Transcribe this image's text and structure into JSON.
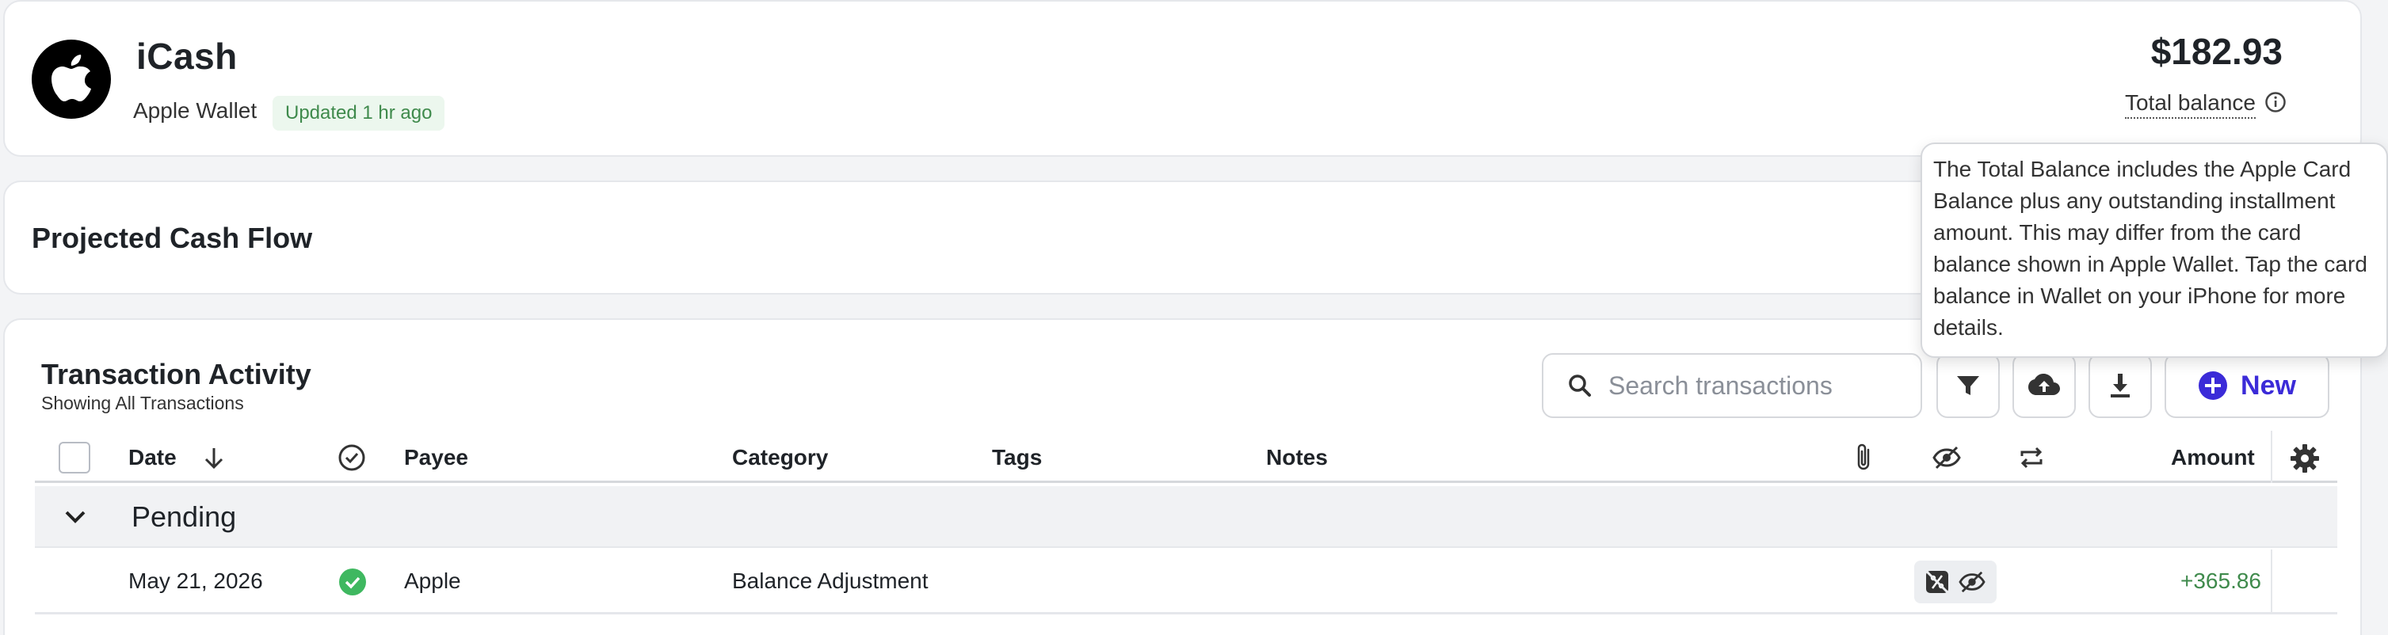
{
  "account": {
    "name": "iCash",
    "source": "Apple Wallet",
    "updated": "Updated 1 hr ago",
    "balance": "$182.93",
    "balance_label": "Total balance",
    "logo_icon": "apple-logo-icon"
  },
  "cashflow": {
    "title": "Projected Cash Flow"
  },
  "activity": {
    "title": "Transaction Activity",
    "subtitle": "Showing All Transactions",
    "search_placeholder": "Search transactions",
    "new_label": "New",
    "columns": {
      "date": "Date",
      "payee": "Payee",
      "category": "Category",
      "tags": "Tags",
      "notes": "Notes",
      "amount": "Amount"
    },
    "groups": [
      {
        "label": "Pending",
        "transactions": [
          {
            "date": "May 21, 2026",
            "reviewed": true,
            "payee": "Apple",
            "category": "Balance Adjustment",
            "tags": "",
            "notes": "",
            "amount": "+365.86"
          }
        ]
      }
    ]
  },
  "tooltip": {
    "text": "The Total Balance includes the Apple Card Balance plus any outstanding installment amount. This may differ from the card balance shown in Apple Wallet. Tap the card balance in Wallet on your iPhone for more details."
  },
  "colors": {
    "accent": "#3b2bd8",
    "positive": "#3f8a4c",
    "badge_bg": "#ecf7ee",
    "check_green": "#3fb860"
  }
}
